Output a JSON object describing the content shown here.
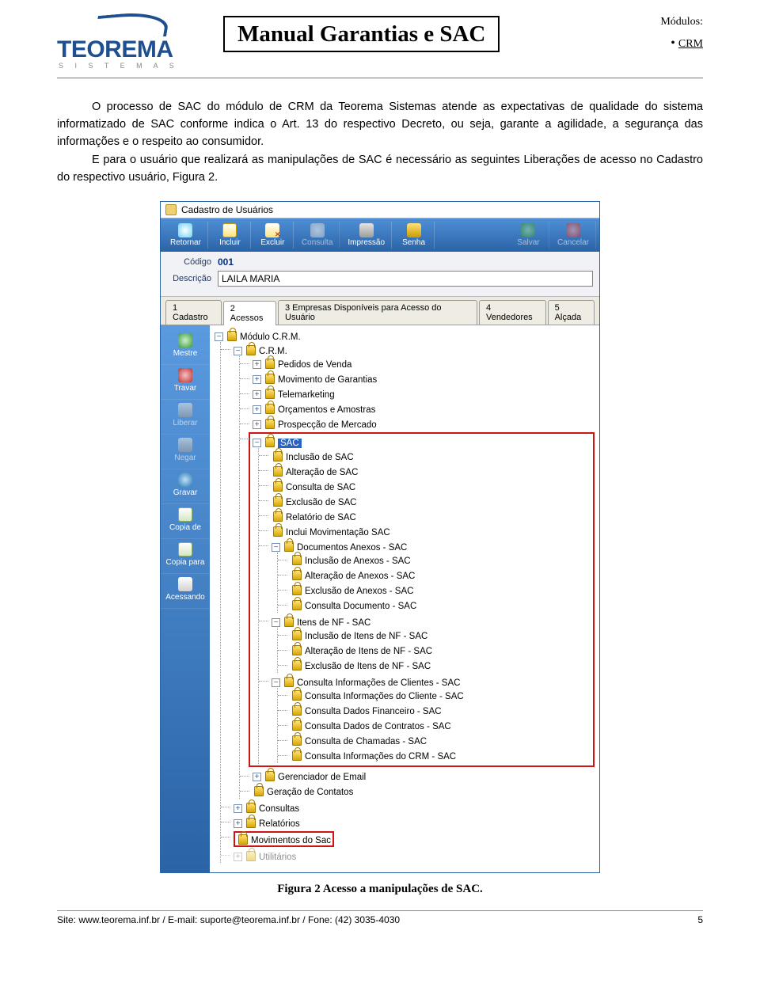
{
  "header": {
    "logo_text": "TEOREMA",
    "logo_sub": "S I S T E M A S",
    "title": "Manual Garantias e SAC",
    "modules_label": "Módulos:",
    "modules_item": "CRM"
  },
  "body": {
    "p1": "O processo de SAC do módulo de CRM da Teorema Sistemas atende as expectativas de qualidade do sistema informatizado de SAC conforme indica o Art. 13 do respectivo Decreto, ou seja, garante a agilidade, a segurança das informações e o respeito ao consumidor.",
    "p2": "E para o usuário que realizará as manipulações de SAC é necessário as seguintes Liberações de acesso no Cadastro do respectivo usuário, Figura 2."
  },
  "screenshot": {
    "window_title": "Cadastro de Usuários",
    "toolbar": {
      "retornar": "Retornar",
      "incluir": "Incluir",
      "excluir": "Excluir",
      "consulta": "Consulta",
      "impressao": "Impressão",
      "senha": "Senha",
      "salvar": "Salvar",
      "cancelar": "Cancelar"
    },
    "form": {
      "codigo_label": "Código",
      "codigo_value": "001",
      "descricao_label": "Descrição",
      "descricao_value": "LAILA MARIA"
    },
    "tabs": {
      "t1": "1 Cadastro",
      "t2": "2 Acessos",
      "t3": "3 Empresas Disponíveis para Acesso do Usuário",
      "t4": "4 Vendedores",
      "t5": "5 Alçada"
    },
    "sidebar": {
      "mestre": "Mestre",
      "travar": "Travar",
      "liberar": "Liberar",
      "negar": "Negar",
      "gravar": "Gravar",
      "copiade": "Copia de",
      "copiapara": "Copia para",
      "acessando": "Acessando"
    },
    "tree": {
      "root": "Módulo C.R.M.",
      "crm": "C.R.M.",
      "pedidos": "Pedidos de Venda",
      "movgar": "Movimento de Garantias",
      "tele": "Telemarketing",
      "orc": "Orçamentos e Amostras",
      "prosp": "Prospecção de Mercado",
      "sac": "SAC",
      "sac_items": [
        "Inclusão de SAC",
        "Alteração de SAC",
        "Consulta de SAC",
        "Exclusão de SAC",
        "Relatório de SAC",
        "Inclui Movimentação SAC"
      ],
      "docanex": "Documentos Anexos - SAC",
      "docanex_items": [
        "Inclusão de Anexos - SAC",
        "Alteração de Anexos - SAC",
        "Exclusão de Anexos - SAC",
        "Consulta Documento - SAC"
      ],
      "itensnf": "Itens de NF - SAC",
      "itensnf_items": [
        "Inclusão de Itens de NF - SAC",
        "Alteração de Itens de NF - SAC",
        "Exclusão de Itens de NF - SAC"
      ],
      "consinfo": "Consulta Informações de Clientes - SAC",
      "consinfo_items": [
        "Consulta Informações do Cliente - SAC",
        "Consulta Dados Financeiro - SAC",
        "Consulta Dados de Contratos  - SAC",
        "Consulta de Chamadas - SAC",
        "Consulta Informações do CRM - SAC"
      ],
      "geremail": "Gerenciador de Email",
      "gercont": "Geração de Contatos",
      "consultas": "Consultas",
      "relatorios": "Relatórios",
      "movsac": "Movimentos do Sac",
      "util": "Utilitários"
    }
  },
  "caption": "Figura 2 Acesso a manipulações de SAC.",
  "footer": {
    "left": "Site: www.teorema.inf.br / E-mail: suporte@teorema.inf.br / Fone: (42) 3035-4030",
    "page": "5"
  }
}
